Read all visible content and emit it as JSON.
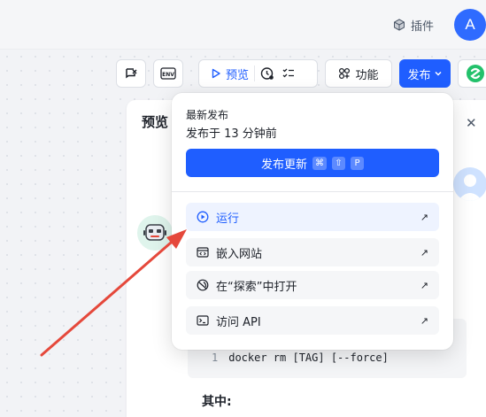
{
  "topbar": {
    "plugin_label": "插件",
    "avatar_letter": "A"
  },
  "toolbar": {
    "preview_label": "预览",
    "function_label": "功能",
    "publish_label": "发布",
    "env_label": "ENV"
  },
  "preview_panel": {
    "title": "预览",
    "code_line_number": "1",
    "code_text": "docker rm [TAG] [--force]",
    "among_label": "其中:"
  },
  "dropdown": {
    "latest_label": "最新发布",
    "published_time": "发布于 13 分钟前",
    "update_button": "发布更新",
    "shortcut_keys": [
      "⌘",
      "⇧",
      "P"
    ],
    "items": [
      {
        "label": "运行",
        "icon": "play-circle-icon"
      },
      {
        "label": "嵌入网站",
        "icon": "embed-icon"
      },
      {
        "label": "在“探索”中打开",
        "icon": "explore-icon"
      },
      {
        "label": "访问 API",
        "icon": "terminal-icon"
      }
    ]
  },
  "colors": {
    "accent": "#1f5eff",
    "annotation_arrow": "#e5483b"
  }
}
